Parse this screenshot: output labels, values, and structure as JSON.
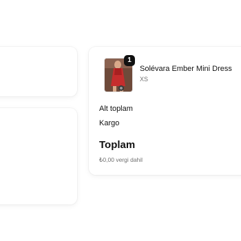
{
  "cart": {
    "item": {
      "quantity": "1",
      "name": "Solévara Ember Mini Dress",
      "variant": "XS"
    }
  },
  "summary": {
    "subtotal_label": "Alt toplam",
    "shipping_label": "Kargo",
    "total_label": "Toplam",
    "tax_note": "₺0,00 vergi dahil"
  }
}
